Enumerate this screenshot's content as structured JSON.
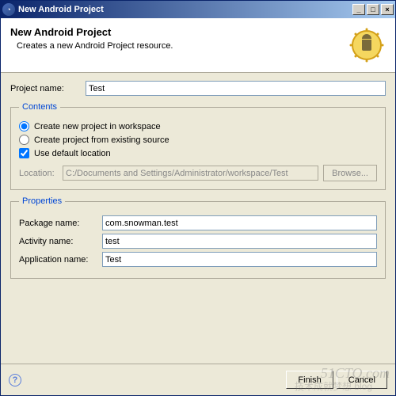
{
  "titlebar": {
    "title": "New Android Project"
  },
  "header": {
    "title": "New Android Project",
    "subtitle": "Creates a new Android Project resource."
  },
  "project": {
    "name_label": "Project name:",
    "name_value": "Test"
  },
  "contents": {
    "legend": "Contents",
    "opt_new": "Create new project in workspace",
    "opt_existing": "Create project from existing source",
    "use_default": "Use default location",
    "location_label": "Location:",
    "location_value": "C:/Documents and Settings/Administrator/workspace/Test",
    "browse": "Browse..."
  },
  "properties": {
    "legend": "Properties",
    "package_label": "Package name:",
    "package_value": "com.snowman.test",
    "activity_label": "Activity name:",
    "activity_value": "test",
    "app_label": "Application name:",
    "app_value": "Test"
  },
  "footer": {
    "finish": "Finish",
    "cancel": "Cancel"
  },
  "watermark": {
    "main": "51CTO.com",
    "sub": "技术成就梦想 blog"
  }
}
